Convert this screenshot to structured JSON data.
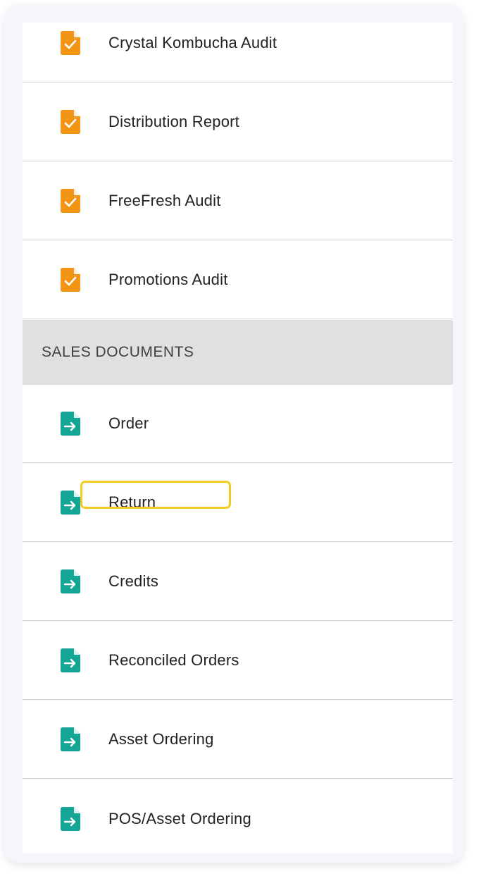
{
  "colors": {
    "audit_icon": "#f29414",
    "sales_icon": "#15a596",
    "section_bg": "#e0e0e0",
    "highlight": "#f5cc21"
  },
  "audits": {
    "items": [
      {
        "label": "Crystal Kombucha Audit",
        "icon": "checked-document-icon"
      },
      {
        "label": "Distribution Report",
        "icon": "checked-document-icon"
      },
      {
        "label": "FreeFresh Audit",
        "icon": "checked-document-icon"
      },
      {
        "label": "Promotions Audit",
        "icon": "checked-document-icon"
      }
    ]
  },
  "sales_documents": {
    "title": "SALES DOCUMENTS",
    "items": [
      {
        "label": "Order",
        "icon": "document-arrow-icon"
      },
      {
        "label": "Return",
        "icon": "document-arrow-icon",
        "highlighted": true
      },
      {
        "label": "Credits",
        "icon": "document-arrow-icon"
      },
      {
        "label": "Reconciled Orders",
        "icon": "document-arrow-icon"
      },
      {
        "label": "Asset Ordering",
        "icon": "document-arrow-icon"
      },
      {
        "label": "POS/Asset Ordering",
        "icon": "document-arrow-icon"
      }
    ]
  }
}
